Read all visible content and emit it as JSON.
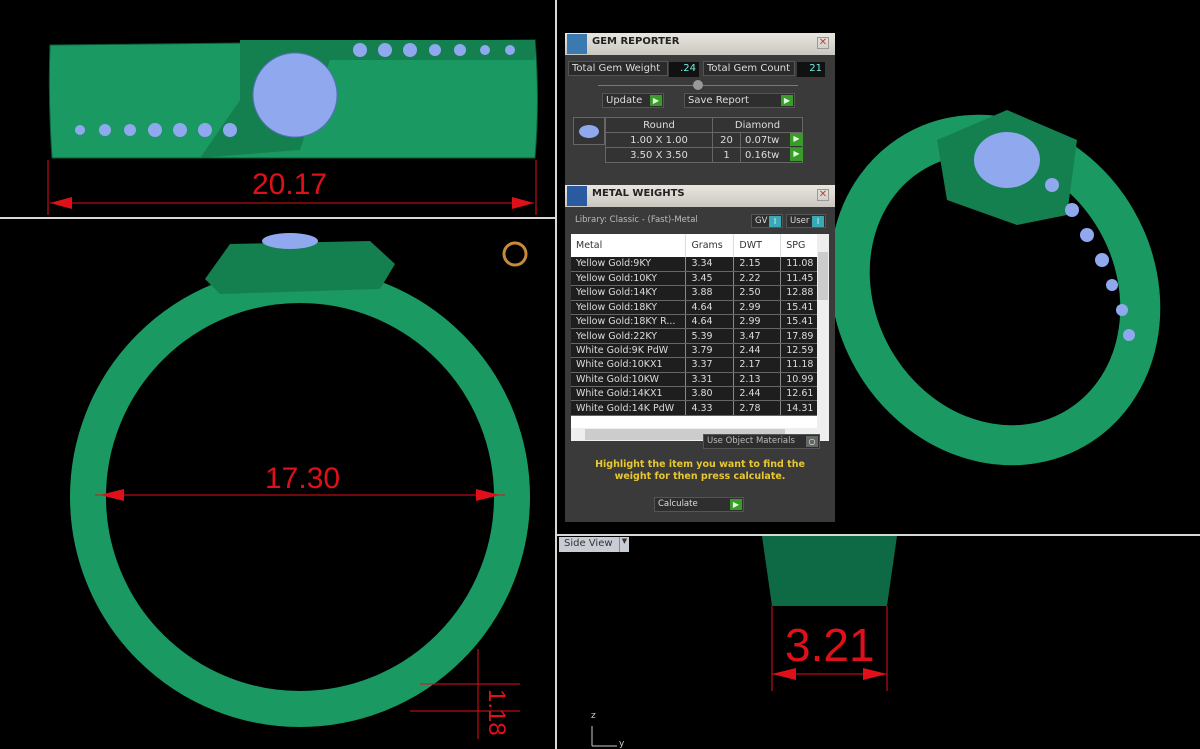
{
  "viewports": {
    "top_left": {
      "dimension": "20.17"
    },
    "bottom_left": {
      "diameter": "17.30",
      "thickness": "1.18"
    },
    "bottom_right": {
      "label": "Side View",
      "width": "3.21",
      "axis_z": "z",
      "axis_y": "y"
    }
  },
  "gem_reporter": {
    "title": "GEM REPORTER",
    "total_weight_label": "Total Gem Weight",
    "total_weight": ".24",
    "total_count_label": "Total Gem Count",
    "total_count": "21",
    "update_label": "Update",
    "save_report_label": "Save Report",
    "shape": "Round",
    "material": "Diamond",
    "rows": [
      {
        "size": "1.00 X 1.00",
        "count": "20",
        "weight": "0.07tw"
      },
      {
        "size": "3.50 X 3.50",
        "count": "1",
        "weight": "0.16tw"
      }
    ]
  },
  "metal_weights": {
    "title": "METAL WEIGHTS",
    "library": "Library: Classic - (Fast)-Metal",
    "gv_label": "GV",
    "user_label": "User",
    "columns": [
      "Metal",
      "Grams",
      "DWT",
      "SPG"
    ],
    "rows": [
      [
        "Yellow Gold:9KY",
        "3.34",
        "2.15",
        "11.08"
      ],
      [
        "Yellow Gold:10KY",
        "3.45",
        "2.22",
        "11.45"
      ],
      [
        "Yellow Gold:14KY",
        "3.88",
        "2.50",
        "12.88"
      ],
      [
        "Yellow Gold:18KY",
        "4.64",
        "2.99",
        "15.41"
      ],
      [
        "Yellow Gold:18KY R...",
        "4.64",
        "2.99",
        "15.41"
      ],
      [
        "Yellow Gold:22KY",
        "5.39",
        "3.47",
        "17.89"
      ],
      [
        "White Gold:9K PdW",
        "3.79",
        "2.44",
        "12.59"
      ],
      [
        "White Gold:10KX1",
        "3.37",
        "2.17",
        "11.18"
      ],
      [
        "White Gold:10KW",
        "3.31",
        "2.13",
        "10.99"
      ],
      [
        "White Gold:14KX1",
        "3.80",
        "2.44",
        "12.61"
      ],
      [
        "White Gold:14K PdW",
        "4.33",
        "2.78",
        "14.31"
      ]
    ],
    "use_object_materials": "Use Object Materials",
    "hint": "Highlight the item you want to find the weight for then press calculate.",
    "calculate_label": "Calculate"
  }
}
